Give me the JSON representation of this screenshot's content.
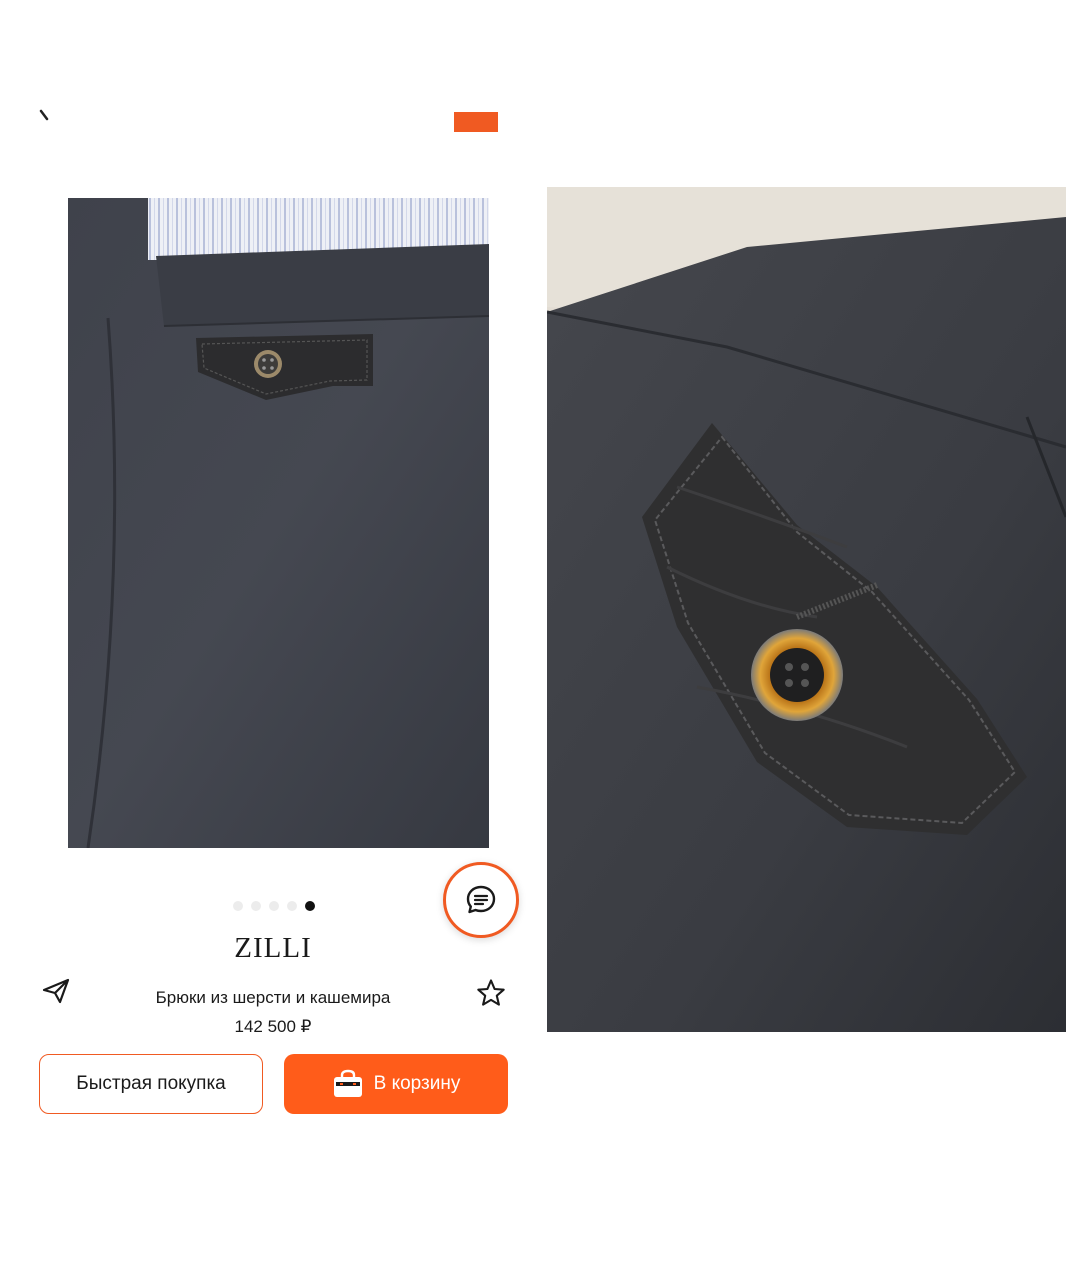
{
  "header": {
    "back_icon": "back-arrow-icon",
    "cart_icon": "shopping-bag-icon"
  },
  "gallery": {
    "image_count": 5,
    "active_index": 4,
    "main_photo": "trouser-waist-leather-pocket-flap",
    "detail_photo": "leather-pocket-flap-closeup"
  },
  "product": {
    "brand": "ZILLI",
    "name": "Брюки из шерсти и кашемира",
    "price": "142 500 ₽"
  },
  "actions": {
    "share_icon": "paper-plane-icon",
    "favorite_icon": "star-outline-icon",
    "chat_icon": "chat-bubble-icon",
    "quick_buy_label": "Быстрая покупка",
    "add_to_cart_label": "В корзину"
  },
  "colors": {
    "accent": "#f05a22",
    "button_primary": "#ff5c1a",
    "fabric": "#3c3f47",
    "leather": "#2b2b2b"
  }
}
